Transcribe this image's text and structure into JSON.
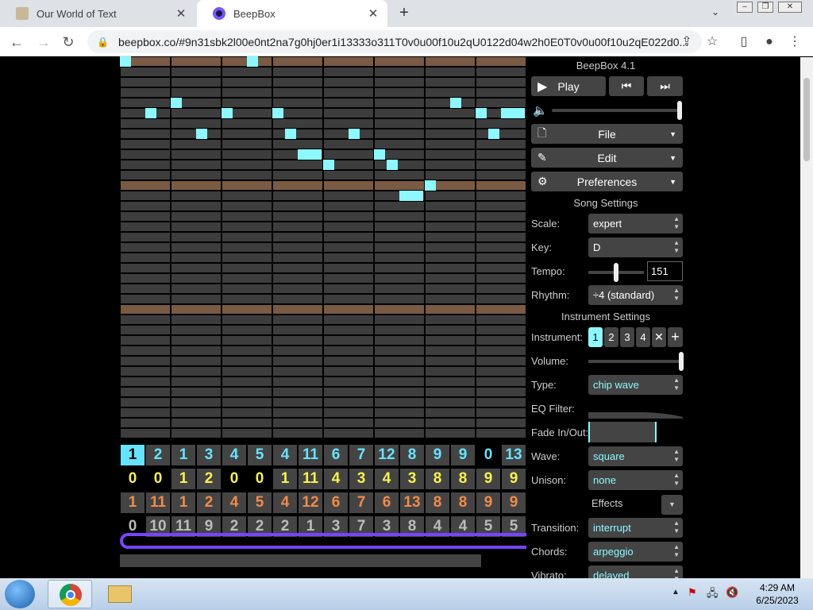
{
  "browser": {
    "tabs": [
      {
        "title": "Our World of Text",
        "active": false
      },
      {
        "title": "BeepBox",
        "active": true
      }
    ],
    "url": "beepbox.co/#9n31sbk2l00e0nt2na7g0hj0er1i13333o311T0v0u00f10u2qU0122d04w2h0E0T0v0u00f10u2qE022d0..."
  },
  "beepbox": {
    "version": "BeepBox 4.1",
    "play_label": "Play",
    "menus": {
      "file": "File",
      "edit": "Edit",
      "preferences": "Preferences"
    },
    "song_settings": {
      "header": "Song Settings",
      "scale_label": "Scale:",
      "scale": "expert",
      "key_label": "Key:",
      "key": "D",
      "tempo_label": "Tempo:",
      "tempo": "151",
      "rhythm_label": "Rhythm:",
      "rhythm": "÷4 (standard)"
    },
    "instrument_settings": {
      "header": "Instrument Settings",
      "instrument_label": "Instrument:",
      "instruments": [
        "1",
        "2",
        "3",
        "4"
      ],
      "volume_label": "Volume:",
      "type_label": "Type:",
      "type": "chip wave",
      "eq_label": "EQ Filter:",
      "fade_label": "Fade In/Out:",
      "wave_label": "Wave:",
      "wave": "square",
      "unison_label": "Unison:",
      "unison": "none",
      "effects_label": "Effects",
      "transition_label": "Transition:",
      "transition": "interrupt",
      "chords_label": "Chords:",
      "chords": "arpeggio",
      "vibrato_label": "Vibrato:",
      "vibrato": "delayed"
    },
    "tracks": [
      {
        "color": "#66e4ff",
        "values": [
          "1",
          "2",
          "1",
          "3",
          "4",
          "5",
          "4",
          "11",
          "6",
          "7",
          "12",
          "8",
          "9",
          "9",
          "0",
          "13"
        ]
      },
      {
        "color": "#f9f24a",
        "values": [
          "0",
          "0",
          "1",
          "2",
          "0",
          "0",
          "1",
          "11",
          "4",
          "3",
          "4",
          "3",
          "8",
          "8",
          "9",
          "9"
        ]
      },
      {
        "color": "#f28a49",
        "values": [
          "1",
          "11",
          "1",
          "2",
          "4",
          "5",
          "4",
          "12",
          "6",
          "7",
          "6",
          "13",
          "8",
          "8",
          "9",
          "9"
        ]
      },
      {
        "color": "#bbbbbb",
        "values": [
          "0",
          "10",
          "11",
          "9",
          "2",
          "2",
          "2",
          "1",
          "3",
          "7",
          "3",
          "8",
          "4",
          "4",
          "5",
          "5"
        ]
      }
    ]
  },
  "taskbar": {
    "time": "4:29 AM",
    "date": "6/25/2023"
  }
}
